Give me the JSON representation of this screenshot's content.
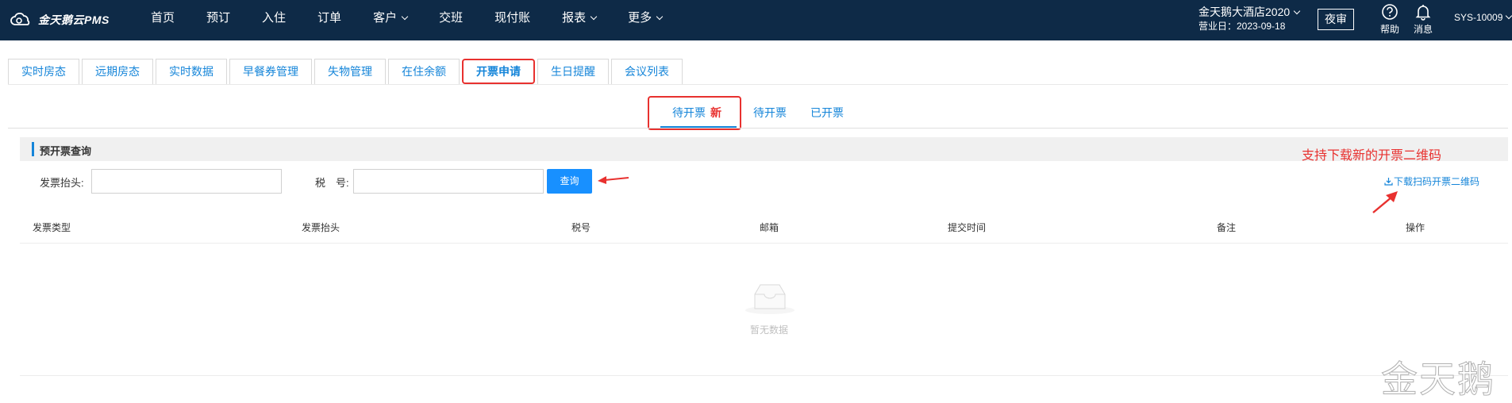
{
  "brand": {
    "name": "金天鹅云PMS"
  },
  "nav": {
    "items": [
      {
        "label": "首页",
        "dropdown": false
      },
      {
        "label": "预订",
        "dropdown": false
      },
      {
        "label": "入住",
        "dropdown": false
      },
      {
        "label": "订单",
        "dropdown": false
      },
      {
        "label": "客户",
        "dropdown": true
      },
      {
        "label": "交班",
        "dropdown": false
      },
      {
        "label": "现付账",
        "dropdown": false
      },
      {
        "label": "报表",
        "dropdown": true
      },
      {
        "label": "更多",
        "dropdown": true
      }
    ]
  },
  "header": {
    "hotel_name": "金天鹅大酒店2020",
    "business_date": "营业日：2023-09-18",
    "audit_label": "夜审",
    "help_label": "帮助",
    "messages_label": "消息",
    "user": "SYS-10009"
  },
  "module_tabs": [
    {
      "label": "实时房态",
      "active": false
    },
    {
      "label": "远期房态",
      "active": false
    },
    {
      "label": "实时数据",
      "active": false
    },
    {
      "label": "早餐券管理",
      "active": false
    },
    {
      "label": "失物管理",
      "active": false
    },
    {
      "label": "在住余额",
      "active": false
    },
    {
      "label": "开票申请",
      "active": true
    },
    {
      "label": "生日提醒",
      "active": false
    },
    {
      "label": "会议列表",
      "active": false
    }
  ],
  "sub_tabs": {
    "pending": "待开票",
    "new_badge": "新",
    "to_invoice": "待开票",
    "invoiced": "已开票"
  },
  "query": {
    "panel_title": "预开票查询",
    "invoice_title_label": "发票抬头:",
    "invoice_title_value": "",
    "tax_no_label": "税　号:",
    "tax_no_value": "",
    "query_button": "查询",
    "annotation": "支持下载新的开票二维码",
    "download_link": "下载扫码开票二维码"
  },
  "table": {
    "columns": [
      "发票类型",
      "发票抬头",
      "税号",
      "邮箱",
      "提交时间",
      "备注",
      "操作"
    ],
    "rows": [],
    "empty_text": "暂无数据"
  },
  "watermark": "金天鹅",
  "colors": {
    "topbar": "#0e2a47",
    "link": "#1585d9",
    "primary_button": "#1890ff",
    "annotation_red": "#e8312f"
  }
}
